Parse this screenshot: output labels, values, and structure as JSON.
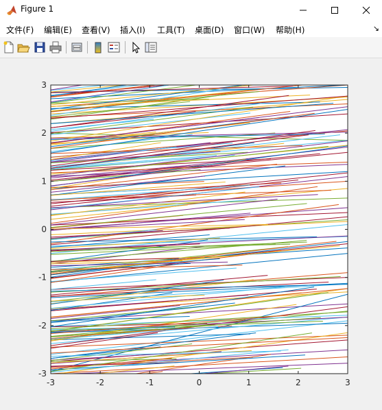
{
  "window": {
    "title": "Figure 1",
    "controls": [
      "minimize",
      "maximize",
      "close"
    ]
  },
  "menu": [
    "文件(F)",
    "编辑(E)",
    "查看(V)",
    "插入(I)",
    "工具(T)",
    "桌面(D)",
    "窗口(W)",
    "帮助(H)"
  ],
  "menu_arrow": "↘",
  "toolbar": [
    "new-figure-icon",
    "open-icon",
    "save-icon",
    "print-icon",
    "link-plot-icon",
    "colorbar-icon",
    "legend-icon",
    "pointer-icon",
    "property-editor-icon"
  ],
  "colors": {
    "series": [
      "#0072BD",
      "#D95319",
      "#EDB120",
      "#7E2F8E",
      "#77AC30",
      "#4DBEEE",
      "#A2142F"
    ]
  },
  "chart_data": {
    "type": "line",
    "title": "",
    "xlabel": "",
    "ylabel": "",
    "xlim": [
      -3,
      3
    ],
    "ylim": [
      -3,
      3
    ],
    "xticks": [
      "-3",
      "-2",
      "-1",
      "0",
      "1",
      "2",
      "3"
    ],
    "yticks": [
      "3",
      "2",
      "1",
      "0",
      "-1",
      "-2",
      "-3"
    ],
    "grid": false,
    "legend": "none",
    "description": "Many overlapping nearly horizontal, slightly rising line segments in cycling MATLAB default colors",
    "segments": [
      {
        "x": [
          -3,
          3
        ],
        "y": [
          2.85,
          2.95
        ]
      },
      {
        "x": [
          -3,
          3
        ],
        "y": [
          2.55,
          3.0
        ]
      },
      {
        "x": [
          -3,
          3
        ],
        "y": [
          2.2,
          2.7
        ]
      },
      {
        "x": [
          -3,
          3
        ],
        "y": [
          1.8,
          2.55
        ]
      },
      {
        "x": [
          -3,
          3
        ],
        "y": [
          2.0,
          1.85
        ]
      },
      {
        "x": [
          -3,
          3
        ],
        "y": [
          1.3,
          1.85
        ]
      },
      {
        "x": [
          -3,
          3
        ],
        "y": [
          1.0,
          1.6
        ]
      },
      {
        "x": [
          -3,
          3
        ],
        "y": [
          0.85,
          1.2
        ]
      },
      {
        "x": [
          -3,
          3
        ],
        "y": [
          0.6,
          1.0
        ]
      },
      {
        "x": [
          -3,
          3
        ],
        "y": [
          0.3,
          0.85
        ]
      },
      {
        "x": [
          -3,
          3
        ],
        "y": [
          0.0,
          0.45
        ]
      },
      {
        "x": [
          -3,
          3
        ],
        "y": [
          -0.2,
          0.2
        ]
      },
      {
        "x": [
          -3,
          3
        ],
        "y": [
          -0.5,
          0.1
        ]
      },
      {
        "x": [
          -3,
          3
        ],
        "y": [
          -0.9,
          -0.3
        ]
      },
      {
        "x": [
          -3,
          3
        ],
        "y": [
          -1.1,
          -0.5
        ]
      },
      {
        "x": [
          -3,
          3
        ],
        "y": [
          -1.4,
          -0.9
        ]
      },
      {
        "x": [
          -3,
          3
        ],
        "y": [
          -1.65,
          -1.3
        ]
      },
      {
        "x": [
          -3,
          3
        ],
        "y": [
          -1.9,
          -1.55
        ]
      },
      {
        "x": [
          -3,
          3
        ],
        "y": [
          -2.3,
          -1.7
        ]
      },
      {
        "x": [
          -3,
          3
        ],
        "y": [
          -2.6,
          -1.9
        ]
      },
      {
        "x": [
          -3,
          3
        ],
        "y": [
          -2.75,
          -2.3
        ]
      },
      {
        "x": [
          -3,
          3
        ],
        "y": [
          -2.95,
          -1.35
        ]
      },
      {
        "x": [
          -3,
          3
        ],
        "y": [
          -3.0,
          -2.65
        ]
      },
      {
        "x": [
          -3,
          3
        ],
        "y": [
          2.4,
          2.75
        ]
      },
      {
        "x": [
          -3,
          3
        ],
        "y": [
          1.1,
          1.35
        ]
      },
      {
        "x": [
          -3,
          3
        ],
        "y": [
          0.45,
          0.65
        ]
      },
      {
        "x": [
          -3,
          3
        ],
        "y": [
          -0.35,
          -0.15
        ]
      },
      {
        "x": [
          -3,
          3
        ],
        "y": [
          -1.25,
          -1.0
        ]
      },
      {
        "x": [
          -3,
          3
        ],
        "y": [
          -2.15,
          -1.95
        ]
      },
      {
        "x": [
          -3,
          3
        ],
        "y": [
          -2.45,
          -2.2
        ]
      }
    ]
  }
}
